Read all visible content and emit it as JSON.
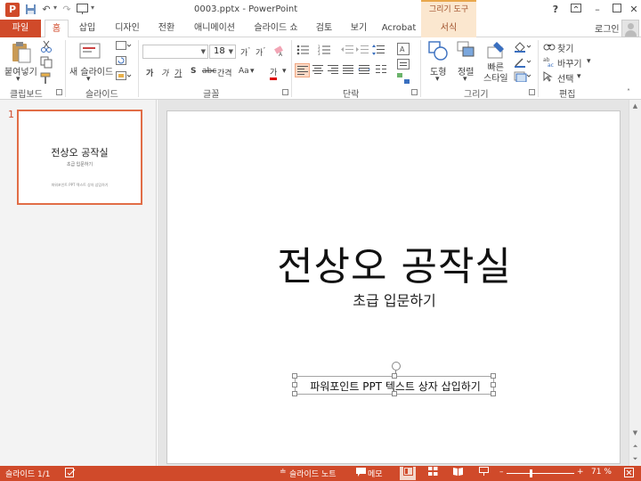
{
  "window": {
    "title": "0003.pptx - PowerPoint",
    "context_tab_header": "그리기 도구",
    "help": "?",
    "controls": [
      "▭",
      "–",
      "▢",
      "✕"
    ]
  },
  "quick_access": {
    "save": "💾",
    "undo": "↶",
    "redo": "↷",
    "start": "▣",
    "customize": "▾"
  },
  "tabs": [
    {
      "label": "파일",
      "id": "file"
    },
    {
      "label": "홈",
      "id": "home"
    },
    {
      "label": "삽입",
      "id": "insert"
    },
    {
      "label": "디자인",
      "id": "design"
    },
    {
      "label": "전환",
      "id": "transitions"
    },
    {
      "label": "애니메이션",
      "id": "animations"
    },
    {
      "label": "슬라이드 쇼",
      "id": "slideshow"
    },
    {
      "label": "검토",
      "id": "review"
    },
    {
      "label": "보기",
      "id": "view"
    },
    {
      "label": "Acrobat",
      "id": "acrobat"
    },
    {
      "label": "서식",
      "id": "format"
    }
  ],
  "user": {
    "name": "로그인"
  },
  "ribbon": {
    "clipboard": {
      "label": "클립보드",
      "paste": "붙여넣기"
    },
    "slides": {
      "label": "슬라이드",
      "new_slide": "새 슬라이드"
    },
    "font": {
      "label": "글꼴",
      "font_name": "",
      "font_size": "18",
      "bold": "가",
      "italic": "가",
      "underline": "가",
      "strike": "S",
      "spacing": "간격",
      "case": "Aa",
      "color": "가"
    },
    "paragraph": {
      "label": "단락"
    },
    "drawing": {
      "label": "그리기",
      "shapes": "도형",
      "arrange": "정렬",
      "quick_styles": "빠른\n스타일"
    },
    "editing": {
      "label": "편집",
      "find": "찾기",
      "replace": "바꾸기",
      "select": "선택"
    }
  },
  "thumbnail": {
    "number": "1",
    "title": "전상오 공작실",
    "subtitle": "초급 입문하기",
    "textbox": "파워포인트 PPT 텍스트 상자 삽입하기"
  },
  "slide": {
    "title": "전상오 공작실",
    "subtitle": "초급 입문하기",
    "textbox": "파워포인트 PPT 텍스트 상자 삽입하기"
  },
  "status": {
    "slide_info": "슬라이드 1/1",
    "notes": "슬라이드 노트",
    "comments": "메모",
    "zoom": "71 %",
    "zoom_level": 0.71
  },
  "colors": {
    "accent": "#d04a2a",
    "context": "#fbe7cf"
  }
}
